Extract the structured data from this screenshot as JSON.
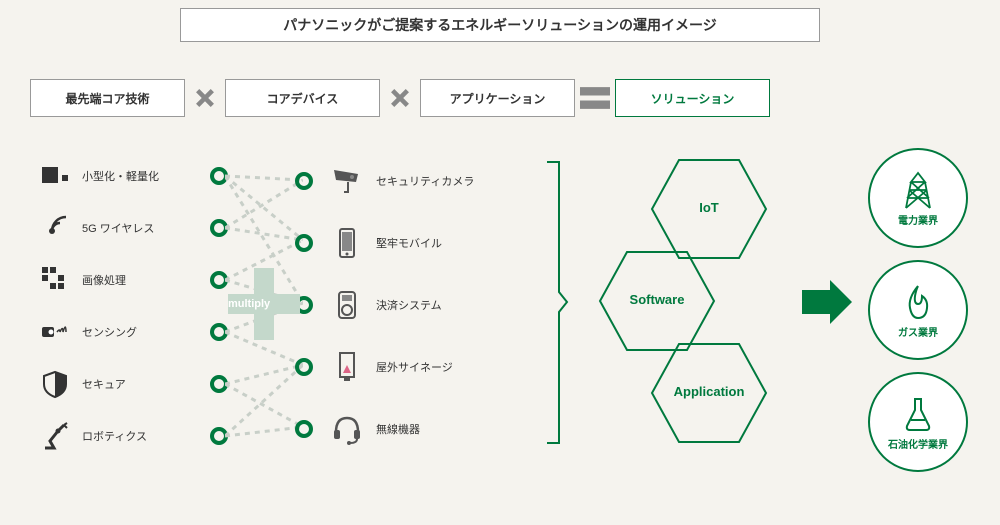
{
  "title": "パナソニックがご提案するエネルギーソリューションの運用イメージ",
  "categories": {
    "tech": "最先端コア技術",
    "device": "コアデバイス",
    "app": "アプリケーション",
    "solution": "ソリューション"
  },
  "multiply_label": "multiply",
  "tech_items": [
    "小型化・軽量化",
    "5G ワイヤレス",
    "画像処理",
    "センシング",
    "セキュア",
    "ロボティクス"
  ],
  "device_items": [
    "セキュリティカメラ",
    "堅牢モバイル",
    "決済システム",
    "屋外サイネージ",
    "無線機器"
  ],
  "hex_labels": {
    "iot": "IoT",
    "software": "Software",
    "application": "Application"
  },
  "solutions": {
    "power": "電力業界",
    "gas": "ガス業界",
    "petro": "石油化学業界"
  },
  "colors": {
    "green": "#00793e",
    "grey": "#888888",
    "lightgrey": "#bbbbbb",
    "cross": "#d8dbd6"
  }
}
